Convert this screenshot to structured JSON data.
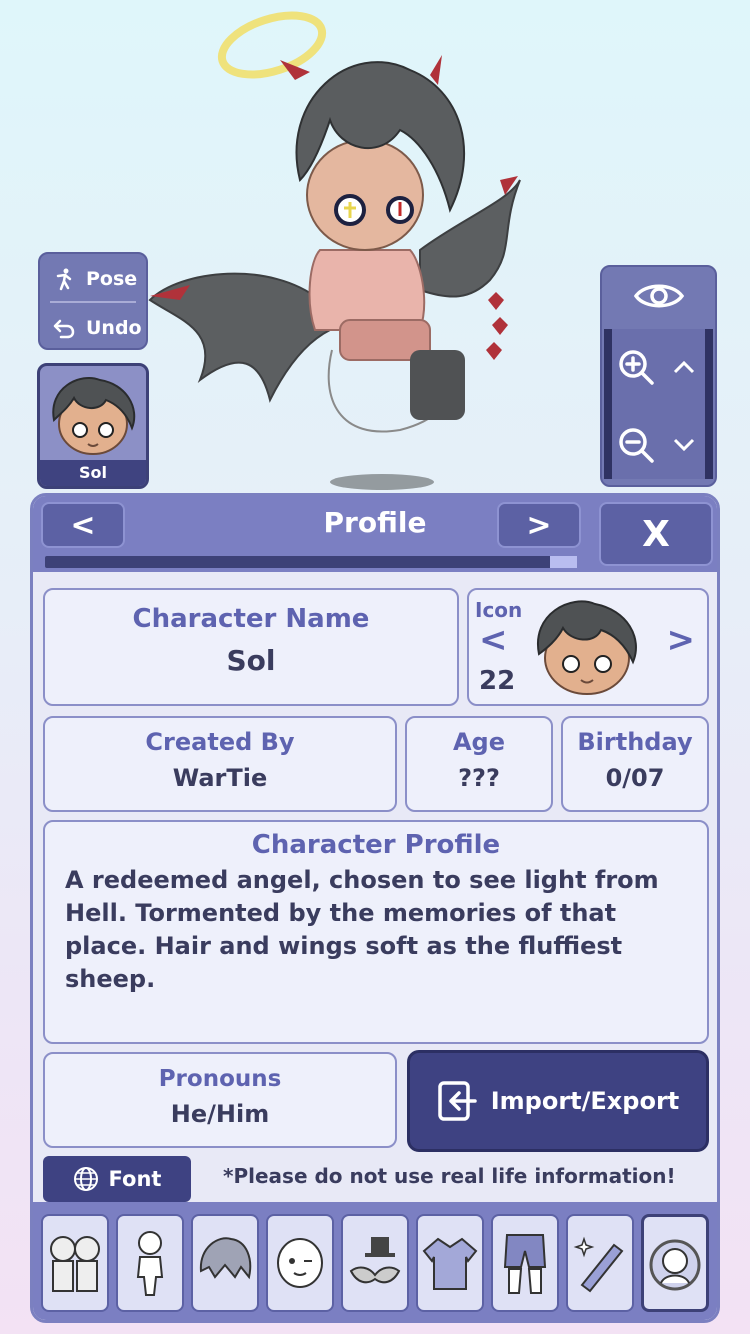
{
  "side": {
    "pose_label": "Pose",
    "undo_label": "Undo"
  },
  "character": {
    "thumb_name": "Sol"
  },
  "profile": {
    "title": "Profile",
    "prev_label": "<",
    "next_label": ">",
    "close_label": "X",
    "progress": 0.05,
    "name_label": "Character Name",
    "name_value": "Sol",
    "icon_label": "Icon",
    "icon_number": "22",
    "icon_prev": "<",
    "icon_next": ">",
    "created_by_label": "Created By",
    "created_by_value": "WarTie",
    "age_label": "Age",
    "age_value": "???",
    "birthday_label": "Birthday",
    "birthday_value": "0/07",
    "profile_label": "Character Profile",
    "profile_text": "A redeemed angel, chosen to see light from Hell. Tormented by the memories of that place. Hair and wings soft as the fluffiest sheep.",
    "pronouns_label": "Pronouns",
    "pronouns_value": "He/Him",
    "import_export_label": "Import/Export",
    "font_label": "Font",
    "disclaimer": "*Please do not use real life information!"
  },
  "tabs": [
    {
      "name": "presets-tab-icon"
    },
    {
      "name": "body-tab-icon"
    },
    {
      "name": "hair-tab-icon"
    },
    {
      "name": "face-tab-icon"
    },
    {
      "name": "accessories-tab-icon"
    },
    {
      "name": "top-clothing-tab-icon"
    },
    {
      "name": "bottom-clothing-tab-icon"
    },
    {
      "name": "props-tab-icon"
    },
    {
      "name": "profile-tab-icon"
    }
  ],
  "colors": {
    "accent": "#7b7fc2",
    "dark": "#3d4177",
    "label": "#5e63b0"
  }
}
